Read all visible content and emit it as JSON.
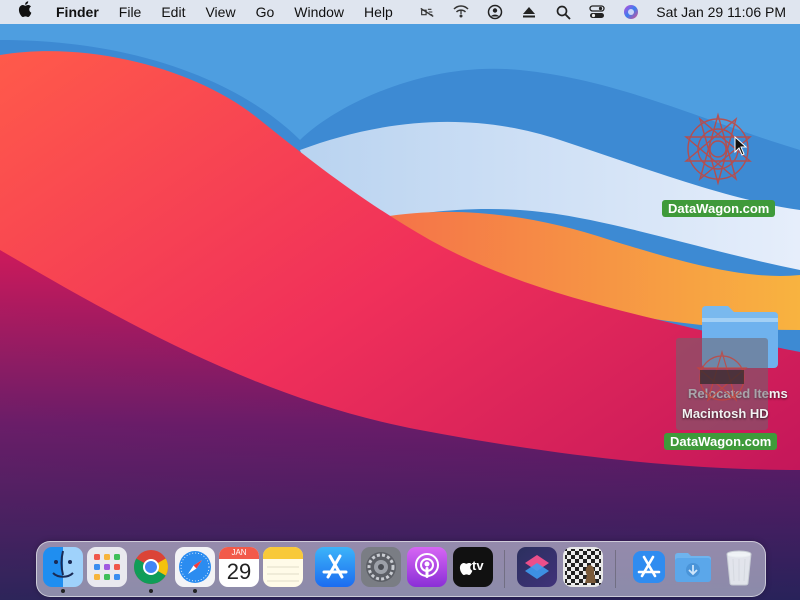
{
  "menubar": {
    "app_name": "Finder",
    "items": [
      "File",
      "Edit",
      "View",
      "Go",
      "Window",
      "Help"
    ],
    "clock": "Sat Jan 29  11:06 PM",
    "status_icons": [
      "mute-icon",
      "wifi-icon",
      "user-icon",
      "eject-icon",
      "search-icon",
      "control-center-icon",
      "siri-icon"
    ]
  },
  "desktop": {
    "icons": [
      {
        "label": "DataWagon.com",
        "kind": "logo"
      },
      {
        "label": "Relocated Items",
        "kind": "folder"
      },
      {
        "label": "Macintosh HD",
        "kind": "drive"
      },
      {
        "label": "DataWagon.com",
        "kind": "logo"
      }
    ]
  },
  "dock": {
    "apps": [
      {
        "name": "Finder",
        "running": true
      },
      {
        "name": "Launchpad",
        "running": false
      },
      {
        "name": "Google Chrome",
        "running": true
      },
      {
        "name": "Safari",
        "running": true
      },
      {
        "name": "Calendar",
        "running": false,
        "month": "JAN",
        "day": "29"
      },
      {
        "name": "Notes",
        "running": false
      },
      {
        "name": "App Store",
        "running": false
      },
      {
        "name": "System Preferences",
        "running": false
      },
      {
        "name": "Podcasts",
        "running": false
      },
      {
        "name": "TV",
        "running": false,
        "label": "tv"
      },
      {
        "name": "Shortcuts",
        "running": false
      },
      {
        "name": "Chess",
        "running": false
      },
      {
        "name": "Applications",
        "running": false
      },
      {
        "name": "Downloads",
        "running": false
      },
      {
        "name": "Trash",
        "running": false
      }
    ]
  },
  "colors": {
    "label_green": "#3f9a3a",
    "wallpaper_red": "#e8304f",
    "wallpaper_orange": "#f7a53a",
    "wallpaper_blue": "#2b6fbf"
  }
}
